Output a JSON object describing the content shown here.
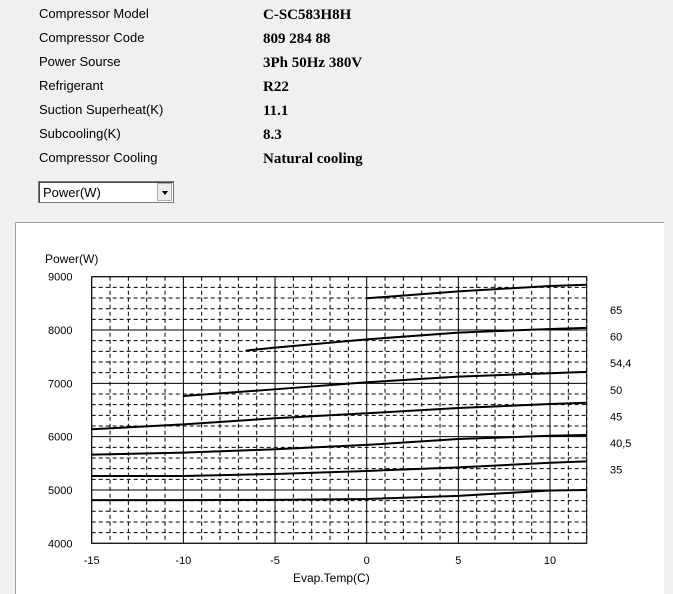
{
  "info": {
    "rows": [
      {
        "label": "Compressor  Model",
        "value": "C-SC583H8H"
      },
      {
        "label": "Compressor Code",
        "value": "809 284 88"
      },
      {
        "label": "Power Sourse",
        "value": "3Ph  50Hz  380V"
      },
      {
        "label": "Refrigerant",
        "value": "R22"
      },
      {
        "label": "Suction Superheat(K)",
        "value": "11.1"
      },
      {
        "label": "Subcooling(K)",
        "value": "8.3"
      },
      {
        "label": "Compressor Cooling",
        "value": "Natural cooling"
      }
    ]
  },
  "selector": {
    "value": "Power(W)"
  },
  "chart_data": {
    "type": "line",
    "title": "",
    "ylabel": "Power(W)",
    "xlabel": "Evap.Temp(C)",
    "xlim": [
      -15,
      12
    ],
    "ylim": [
      4000,
      9000
    ],
    "xticks": [
      -15,
      -10,
      -5,
      0,
      5,
      10
    ],
    "yticks": [
      4000,
      5000,
      6000,
      7000,
      8000,
      9000
    ],
    "grid": true,
    "legend_placement": "right",
    "line_color": "#000000",
    "series": [
      {
        "name": "65",
        "x": [
          0,
          5,
          10,
          12
        ],
        "y": [
          8595,
          8725,
          8825,
          8850
        ]
      },
      {
        "name": "60",
        "x": [
          -6.6,
          -5,
          0,
          5,
          10,
          12
        ],
        "y": [
          7613,
          7670,
          7825,
          7950,
          8020,
          8040
        ]
      },
      {
        "name": "54,4",
        "x": [
          -10,
          -5,
          0,
          5,
          10,
          12
        ],
        "y": [
          6763,
          6888,
          7020,
          7125,
          7190,
          7215
        ]
      },
      {
        "name": "50",
        "x": [
          -15,
          -10,
          -5,
          0,
          5,
          10,
          12
        ],
        "y": [
          6138,
          6230,
          6345,
          6438,
          6537,
          6612,
          6637
        ]
      },
      {
        "name": "45",
        "x": [
          -15,
          -10,
          -5,
          0,
          5,
          10,
          12
        ],
        "y": [
          5663,
          5700,
          5763,
          5845,
          5955,
          6017,
          6030
        ]
      },
      {
        "name": "40,5",
        "x": [
          -15,
          -10,
          -5,
          0,
          5,
          10,
          12
        ],
        "y": [
          5263,
          5263,
          5300,
          5356,
          5425,
          5510,
          5537
        ]
      },
      {
        "name": "35",
        "x": [
          -15,
          -10,
          -5,
          0,
          5,
          10,
          12
        ],
        "y": [
          4810,
          4810,
          4815,
          4830,
          4890,
          4990,
          5000
        ]
      }
    ]
  }
}
